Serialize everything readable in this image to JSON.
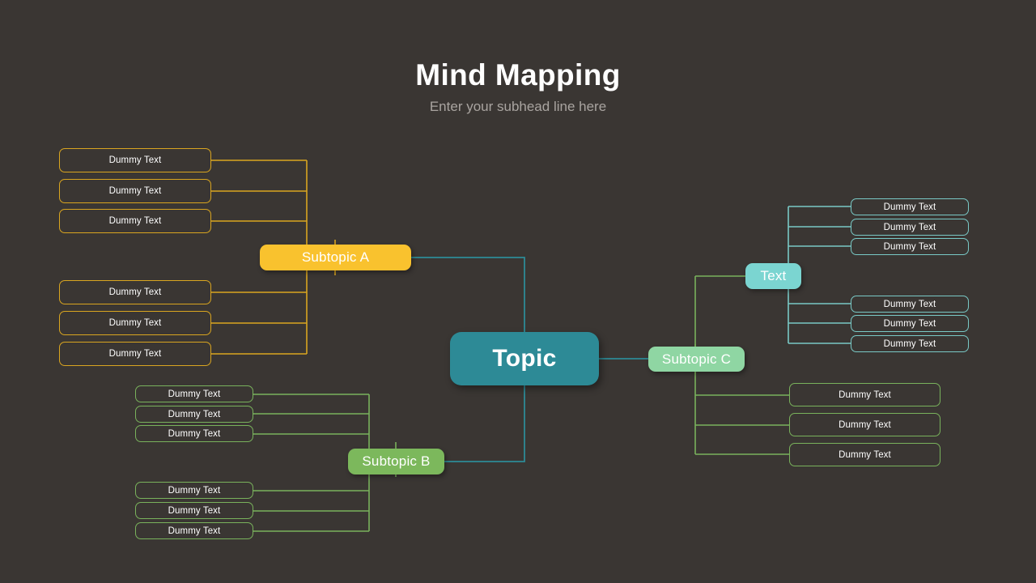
{
  "header": {
    "title": "Mind Mapping",
    "subtitle": "Enter your subhead line here"
  },
  "colors": {
    "background": "#3a3633",
    "amber": "#f9c22e",
    "amber_line": "#d9a520",
    "green": "#7cb85c",
    "green_line": "#79b25c",
    "mint": "#8fd6a3",
    "cyan": "#7bd5d1",
    "cyan_line": "#79c9c6",
    "teal": "#2d8a96",
    "text": "#ffffff",
    "subtitle_text": "#a9a4a0"
  },
  "center": {
    "label": "Topic"
  },
  "branches": {
    "subtopic_a": {
      "label": "Subtopic A",
      "group_top": [
        {
          "label": "Dummy Text"
        },
        {
          "label": "Dummy Text"
        },
        {
          "label": "Dummy Text"
        }
      ],
      "group_bottom": [
        {
          "label": "Dummy Text"
        },
        {
          "label": "Dummy Text"
        },
        {
          "label": "Dummy Text"
        }
      ]
    },
    "subtopic_b": {
      "label": "Subtopic B",
      "group_top": [
        {
          "label": "Dummy Text"
        },
        {
          "label": "Dummy Text"
        },
        {
          "label": "Dummy Text"
        }
      ],
      "group_bottom": [
        {
          "label": "Dummy Text"
        },
        {
          "label": "Dummy Text"
        },
        {
          "label": "Dummy Text"
        }
      ]
    },
    "subtopic_c": {
      "label": "Subtopic C",
      "text_node": {
        "label": "Text",
        "group_top": [
          {
            "label": "Dummy Text"
          },
          {
            "label": "Dummy Text"
          },
          {
            "label": "Dummy Text"
          }
        ],
        "group_bottom": [
          {
            "label": "Dummy Text"
          },
          {
            "label": "Dummy Text"
          },
          {
            "label": "Dummy Text"
          }
        ]
      },
      "group_bottom": [
        {
          "label": "Dummy Text"
        },
        {
          "label": "Dummy Text"
        },
        {
          "label": "Dummy Text"
        }
      ]
    }
  }
}
